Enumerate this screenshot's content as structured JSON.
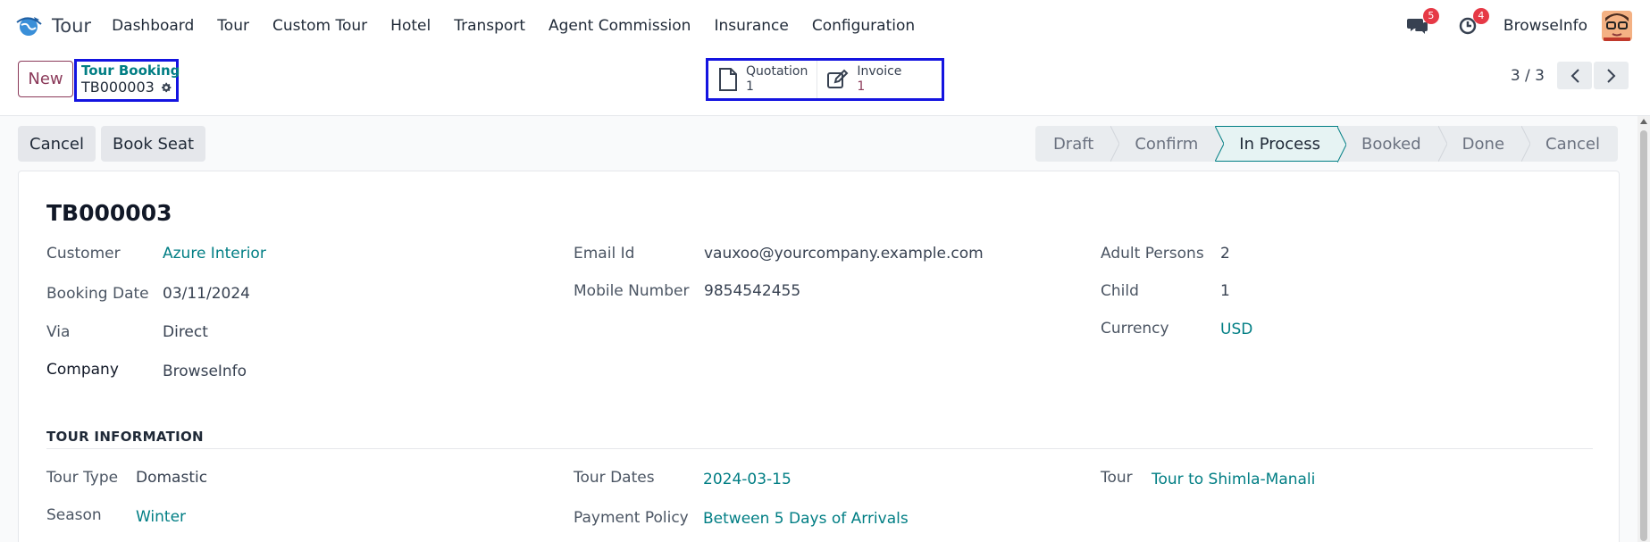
{
  "nav": {
    "app_name": "Tour",
    "menu": [
      "Dashboard",
      "Tour",
      "Custom Tour",
      "Hotel",
      "Transport",
      "Agent Commission",
      "Insurance",
      "Configuration"
    ],
    "messages_badge": "5",
    "activities_badge": "4",
    "company": "BrowseInfo"
  },
  "control": {
    "new_label": "New",
    "breadcrumb_parent": "Tour Booking",
    "breadcrumb_current": "TB000003",
    "smart_buttons": [
      {
        "label": "Quotation",
        "value": "1",
        "icon": "document-icon"
      },
      {
        "label": "Invoice",
        "value": "1",
        "icon": "edit-icon"
      }
    ],
    "pager": "3 / 3"
  },
  "actions": {
    "cancel_label": "Cancel",
    "book_seat_label": "Book Seat"
  },
  "statusbar": {
    "stages": [
      "Draft",
      "Confirm",
      "In Process",
      "Booked",
      "Done",
      "Cancel"
    ],
    "active": "In Process"
  },
  "record": {
    "title": "TB000003",
    "customer_label": "Customer",
    "customer": "Azure Interior",
    "booking_date_label": "Booking Date",
    "booking_date": "03/11/2024",
    "via_label": "Via",
    "via": "Direct",
    "company_label": "Company",
    "company": "BrowseInfo",
    "email_label": "Email Id",
    "email": "vauxoo@yourcompany.example.com",
    "mobile_label": "Mobile Number",
    "mobile": "9854542455",
    "adult_label": "Adult Persons",
    "adult": "2",
    "child_label": "Child",
    "child": "1",
    "currency_label": "Currency",
    "currency": "USD"
  },
  "tour_info": {
    "heading": "TOUR INFORMATION",
    "tour_type_label": "Tour Type",
    "tour_type": "Domastic",
    "season_label": "Season",
    "season": "Winter",
    "tour_dates_label": "Tour Dates",
    "tour_dates": "2024-03-15",
    "payment_policy_label": "Payment Policy",
    "payment_policy": "Between 5 Days of Arrivals",
    "tour_label": "Tour",
    "tour": "Tour to Shimla-Manali"
  },
  "colors": {
    "accent": "#017e84",
    "brand": "#8b3a5a",
    "highlight_box": "#1414e0",
    "badge": "#e63946"
  }
}
